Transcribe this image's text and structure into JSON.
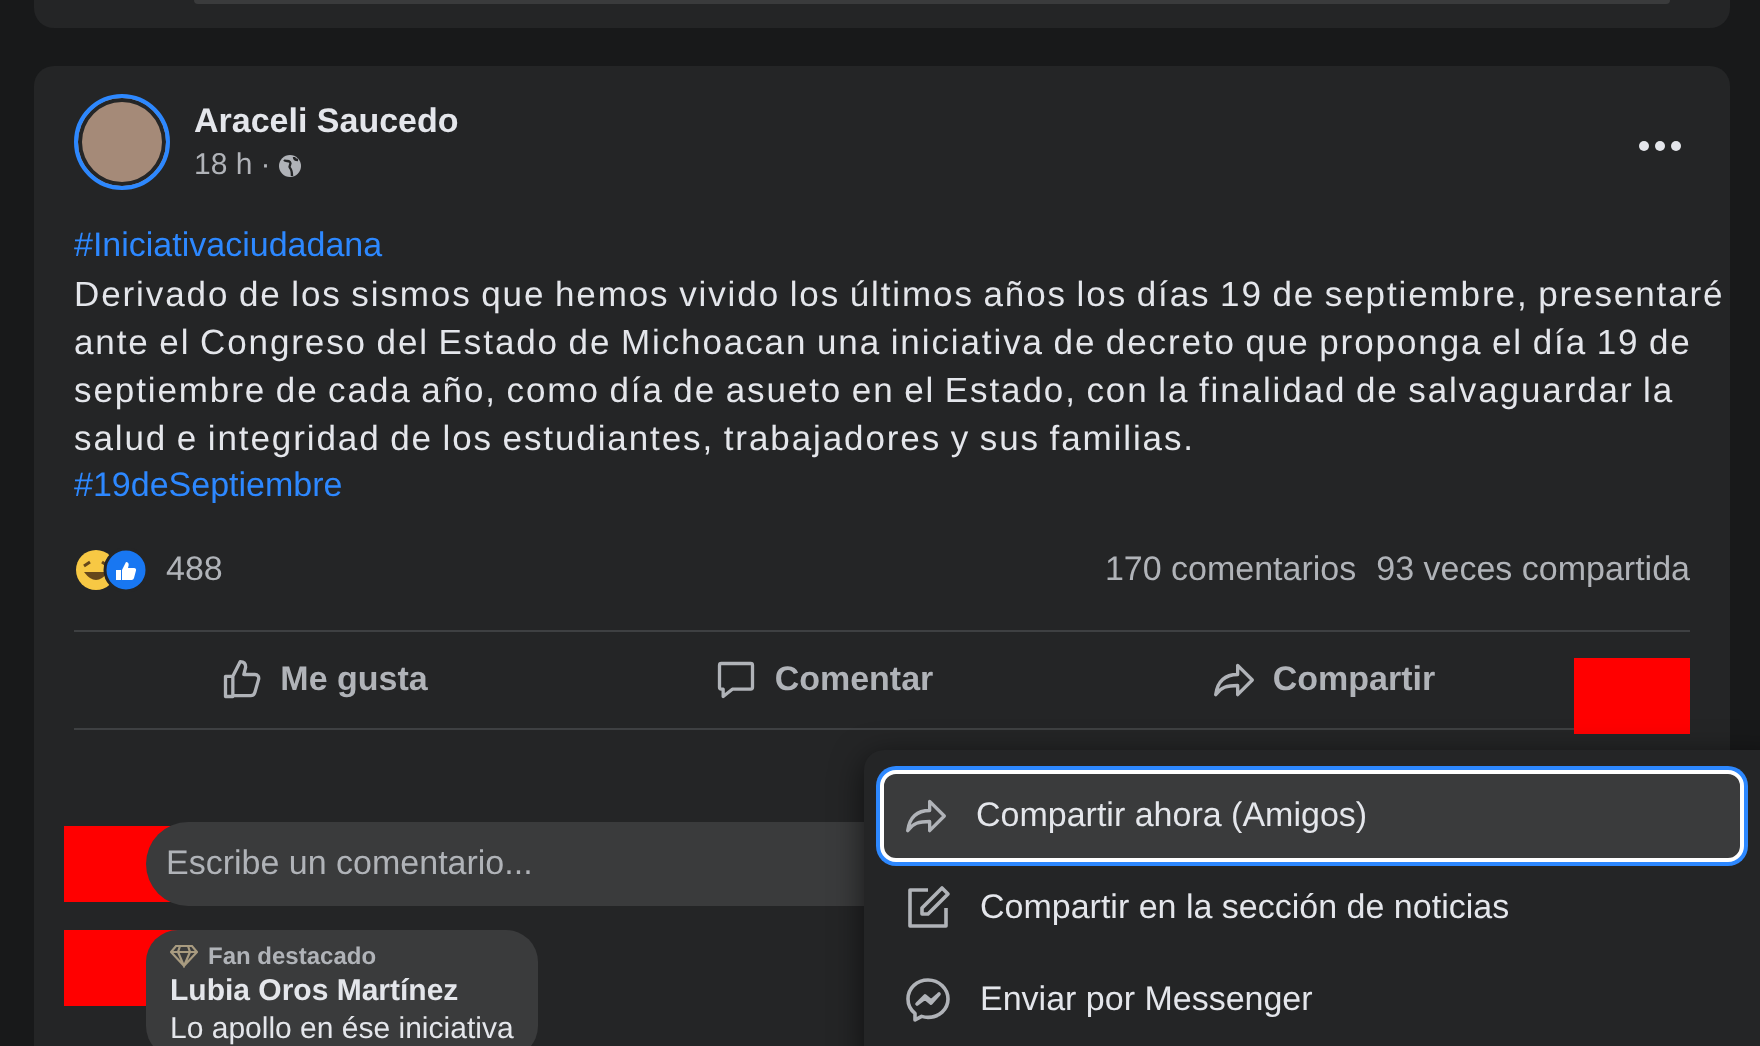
{
  "post": {
    "author": "Araceli Saucedo",
    "time": "18 h",
    "separator": "·",
    "hashtag_top": "#Iniciativaciudadana",
    "body": "Derivado de los sismos que hemos vivido los últimos años los días 19 de septiembre, presentaré ante el Congreso del Estado de Michoacan una iniciativa de decreto que proponga el día 19 de septiembre de cada año, como día de asueto en el Estado, con la finalidad de salvaguardar la salud e integridad de los estudiantes, trabajadores y sus familias.",
    "hashtag_bottom": "#19deSeptiembre",
    "reactions_count": "488",
    "comments_count": "170 comentarios",
    "shares_count": "93 veces compartida"
  },
  "actions": [
    {
      "kind": "like",
      "label": "Me gusta"
    },
    {
      "kind": "comment",
      "label": "Comentar"
    },
    {
      "kind": "share",
      "label": "Compartir"
    }
  ],
  "comment_box": {
    "placeholder": "Escribe un comentario..."
  },
  "comment": {
    "badge": "Fan destacado",
    "author": "Lubia Oros Martínez",
    "text": "Lo apollo en ése iniciativa"
  },
  "share_menu": [
    {
      "kind": "share",
      "label": "Compartir ahora (Amigos)",
      "selected": true
    },
    {
      "kind": "edit",
      "label": "Compartir en la sección de noticias",
      "selected": false
    },
    {
      "kind": "messenger",
      "label": "Enviar por Messenger",
      "selected": false
    }
  ]
}
